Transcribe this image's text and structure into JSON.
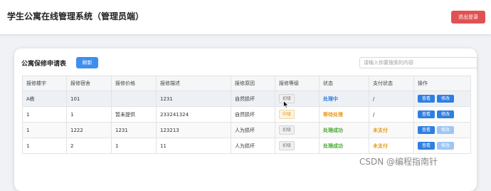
{
  "header": {
    "title": "学生公寓在线管理系统（管理员端）",
    "logout_label": "退出登录"
  },
  "card": {
    "title": "公寓保修申请表",
    "refresh_label": "刷新",
    "search_placeholder": "请输入你要搜索的内容"
  },
  "table": {
    "columns": [
      "报修楼宇",
      "报修宿舍",
      "报修价格",
      "报修描述",
      "报修原因",
      "报修等级",
      "状态",
      "支付状态",
      "操作"
    ],
    "view_label": "查看",
    "edit_label": "修改",
    "rows": [
      {
        "building": "A栋",
        "room": "101",
        "price": "",
        "desc": "1231",
        "reason": "自然损坏",
        "level": "初级",
        "status": "处理中",
        "payment": "/"
      },
      {
        "building": "1",
        "room": "1",
        "price": "暂未提供",
        "desc": "233241324",
        "reason": "自然损坏",
        "level": "中级",
        "status": "等待处理",
        "payment": "/"
      },
      {
        "building": "1",
        "room": "1222",
        "price": "1231",
        "desc": "123213",
        "reason": "人为损坏",
        "level": "初级",
        "status": "处理成功",
        "payment": "未支付"
      },
      {
        "building": "1",
        "room": "2",
        "price": "1",
        "desc": "11",
        "reason": "人为损坏",
        "level": "初级",
        "status": "处理成功",
        "payment": "未支付"
      }
    ]
  },
  "watermark": "CSDN @编程指南针",
  "colors": {
    "danger": "#e05252",
    "primary": "#3d8ef0",
    "status_processing": "#2f7fe0",
    "status_waiting": "#e89a1e",
    "status_success": "#4aa832"
  }
}
